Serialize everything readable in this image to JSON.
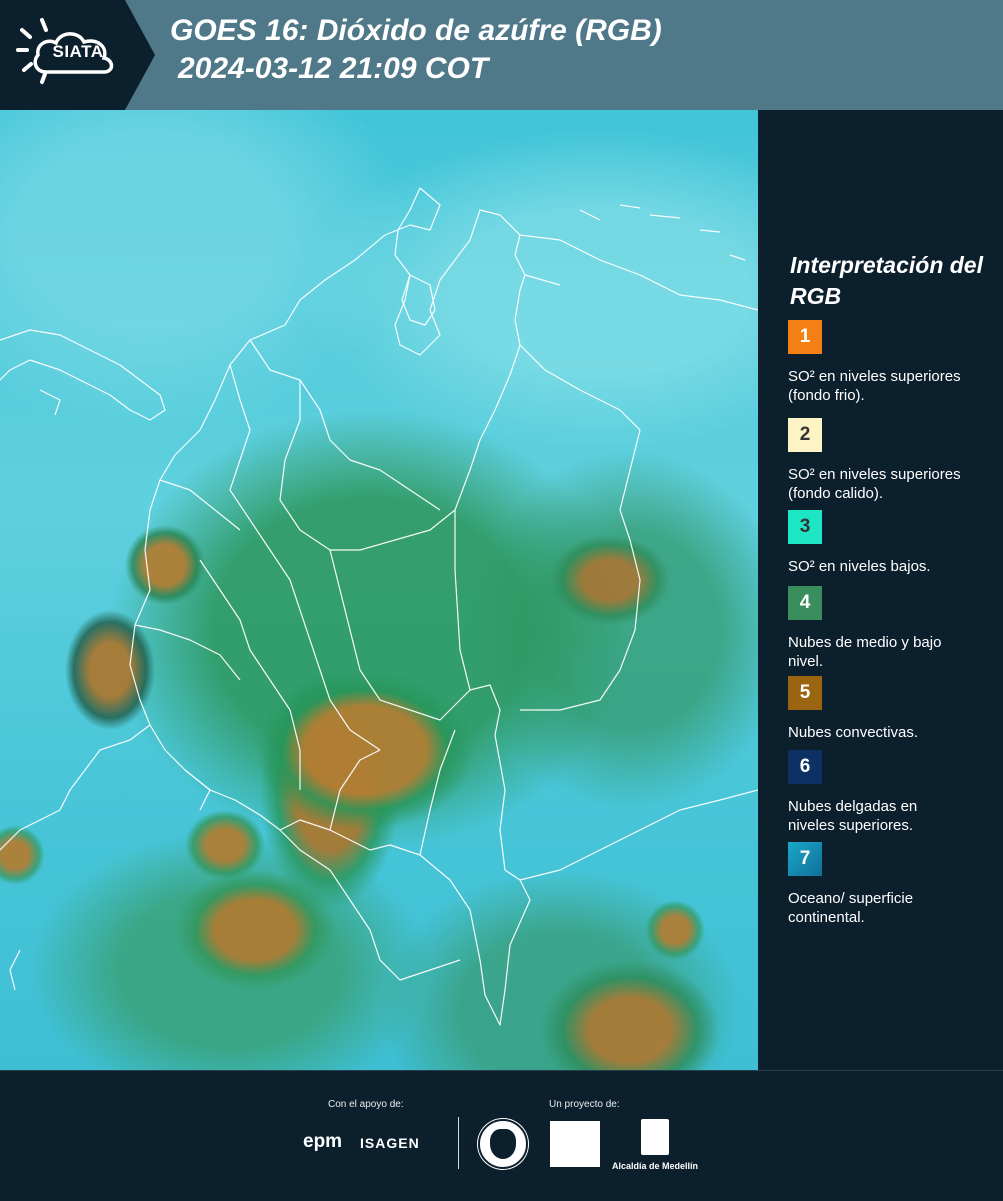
{
  "header": {
    "logo": "SIATA",
    "title_line1": "GOES 16: Dióxido de azúfre (RGB)",
    "title_line2": "2024-03-12 21:09 COT"
  },
  "map": {
    "description_icon": "satellite-rgb-map"
  },
  "legend": {
    "title": "Interpretación del RGB",
    "items": [
      {
        "number": "1",
        "color": "#f47f12",
        "label": "SO² en niveles superiores (fondo frio)."
      },
      {
        "number": "2",
        "color": "#fdf3c4",
        "label": "SO² en niveles superiores (fondo calido)."
      },
      {
        "number": "3",
        "color": "#1de6c5",
        "label": "SO² en niveles bajos."
      },
      {
        "number": "4",
        "color": "#3a8d5c",
        "label": "Nubes de medio y bajo nivel."
      },
      {
        "number": "5",
        "color": "#9a6411",
        "label": "Nubes convectivas."
      },
      {
        "number": "6",
        "color": "#0d3163",
        "label": "Nubes delgadas en niveles superiores."
      },
      {
        "number": "7",
        "color": "#1a8fb5",
        "label": "Oceano/ superficie continental."
      }
    ]
  },
  "footer": {
    "support_label": "Con el apoyo de:",
    "project_label": "Un proyecto de:",
    "epm": "epm",
    "isagen": "ISAGEN",
    "alcaldia": "Alcaldía de Medellín"
  }
}
